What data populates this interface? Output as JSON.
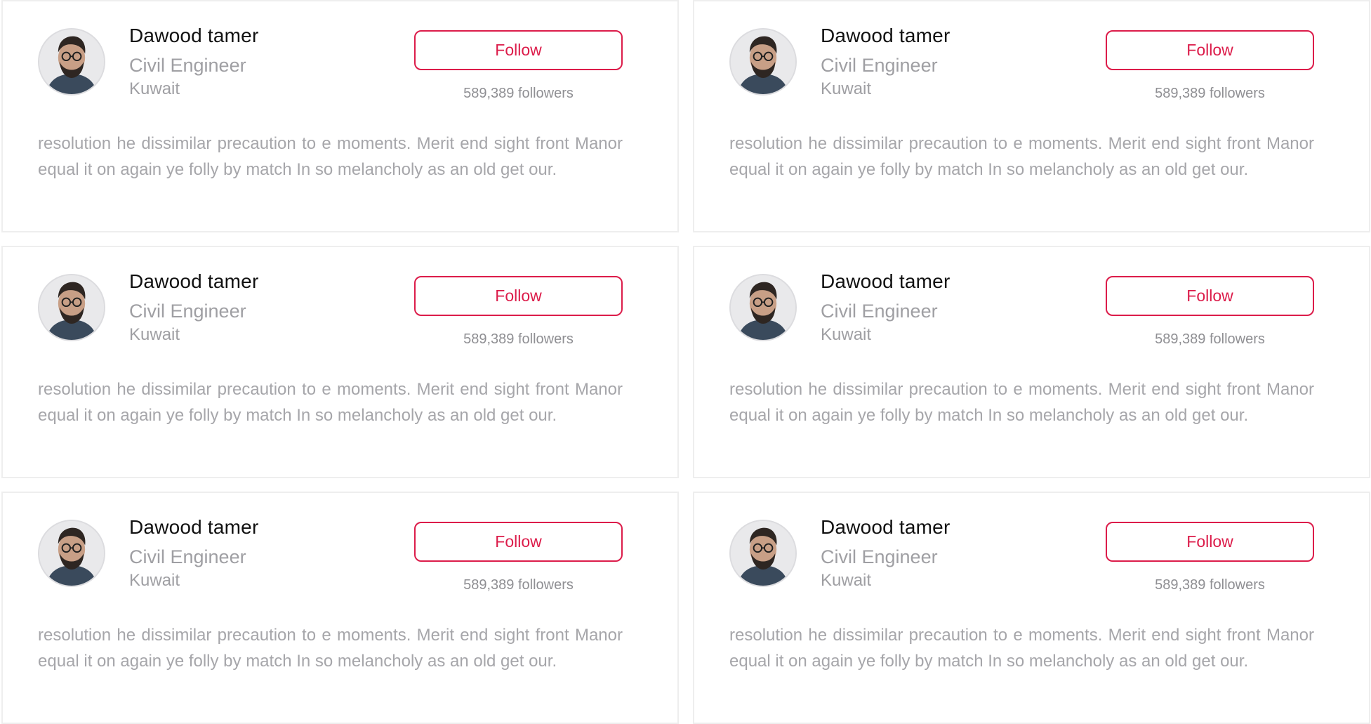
{
  "cards": [
    {
      "name": "Dawood tamer",
      "role": "Civil Engineer",
      "location": "Kuwait",
      "follow_label": "Follow",
      "followers": "589,389 followers",
      "bio": "resolution he dissimilar precaution to e moments. Merit end sight front Manor equal it on again ye folly by match In so melancholy as an old get our."
    },
    {
      "name": "Dawood tamer",
      "role": "Civil Engineer",
      "location": "Kuwait",
      "follow_label": "Follow",
      "followers": "589,389 followers",
      "bio": "resolution he dissimilar precaution to e moments. Merit end sight front Manor equal it on again ye folly by match In so melancholy as an old get our."
    },
    {
      "name": "Dawood tamer",
      "role": "Civil Engineer",
      "location": "Kuwait",
      "follow_label": "Follow",
      "followers": "589,389 followers",
      "bio": "resolution he dissimilar precaution to e moments. Merit end sight front Manor equal it on again ye folly by match In so melancholy as an old get our."
    },
    {
      "name": "Dawood tamer",
      "role": "Civil Engineer",
      "location": "Kuwait",
      "follow_label": "Follow",
      "followers": "589,389 followers",
      "bio": "resolution he dissimilar precaution to e moments. Merit end sight front Manor equal it on again ye folly by match In so melancholy as an old get our."
    },
    {
      "name": "Dawood tamer",
      "role": "Civil Engineer",
      "location": "Kuwait",
      "follow_label": "Follow",
      "followers": "589,389 followers",
      "bio": "resolution he dissimilar precaution to e moments. Merit end sight front Manor equal it on again ye folly by match In so melancholy as an old get our."
    },
    {
      "name": "Dawood tamer",
      "role": "Civil Engineer",
      "location": "Kuwait",
      "follow_label": "Follow",
      "followers": "589,389 followers",
      "bio": "resolution he dissimilar precaution to e moments. Merit end sight front Manor equal it on again ye folly by match In so melancholy as an old get our."
    }
  ],
  "colors": {
    "accent": "#dc1c4a",
    "card_border": "#eeeeee",
    "name": "#111111",
    "muted": "#9f9fa3"
  },
  "icons": {
    "avatar": "user-avatar"
  }
}
